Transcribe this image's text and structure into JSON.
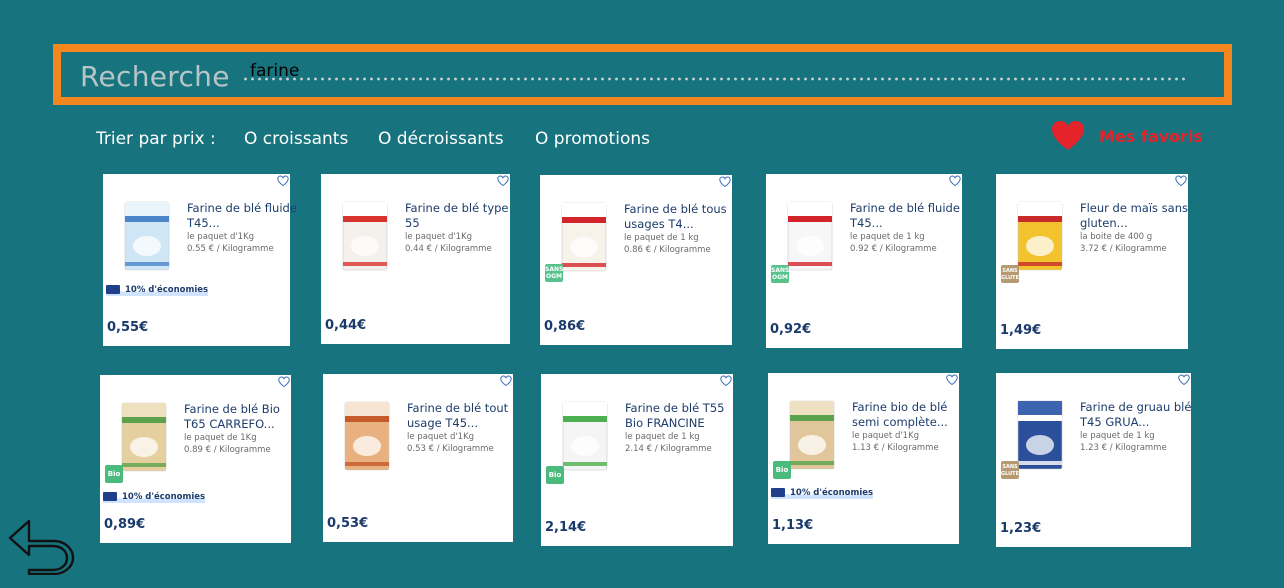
{
  "search": {
    "label": "Recherche",
    "value": "farine"
  },
  "sort": {
    "title": "Trier par prix :",
    "options": [
      "O croissants",
      "O décroissants",
      "O promotions"
    ]
  },
  "favorites": {
    "label": "Mes favoris"
  },
  "colors": {
    "background": "#17747f",
    "search_border": "#f4861f",
    "favorites": "#e4242a",
    "price": "#1a3a6b"
  },
  "icons": {
    "back": "back-arrow-icon",
    "favorite": "heart-icon"
  },
  "products": [
    {
      "name": "Farine de blé fluide T45...",
      "unit": "le paquet d'1Kg",
      "price_per_kg": "0.55 € / Kilogramme",
      "promo": "10% d'économies",
      "price": "0,55€",
      "badge": "",
      "image": "package-blue"
    },
    {
      "name": "Farine de blé type 55",
      "unit": "le paquet d'1Kg",
      "price_per_kg": "0.44 € / Kilogramme",
      "promo": "",
      "price": "0,44€",
      "badge": "",
      "image": "package-white"
    },
    {
      "name": "Farine de blé tous usages T4...",
      "unit": "le paquet de 1 kg",
      "price_per_kg": "0.86 € / Kilogramme",
      "promo": "",
      "price": "0,86€",
      "badge": "SANS OGM",
      "image": "package-francine"
    },
    {
      "name": "Farine de blé fluide T45...",
      "unit": "le paquet de 1 kg",
      "price_per_kg": "0.92 € / Kilogramme",
      "promo": "",
      "price": "0,92€",
      "badge": "SANS OGM",
      "image": "package-francine-blue"
    },
    {
      "name": "Fleur de maïs sans gluten...",
      "unit": "la boite de 400 g",
      "price_per_kg": "3.72 € / Kilogramme",
      "promo": "",
      "price": "1,49€",
      "badge": "SANS GLUTEN",
      "image": "box-maizena"
    },
    {
      "name": "Farine de blé Bio T65 CARREFO...",
      "unit": "le paquet de 1Kg",
      "price_per_kg": "0.89 € / Kilogramme",
      "promo": "10% d'économies",
      "price": "0,89€",
      "badge": "Bio",
      "image": "package-bio-kraft"
    },
    {
      "name": "Farine de blé tout usage T45...",
      "unit": "le paquet d'1Kg",
      "price_per_kg": "0.53 € / Kilogramme",
      "promo": "",
      "price": "0,53€",
      "badge": "",
      "image": "package-orange"
    },
    {
      "name": "Farine de blé T55 Bio FRANCINE",
      "unit": "le paquet de 1 kg",
      "price_per_kg": "2.14 € / Kilogramme",
      "promo": "",
      "price": "2,14€",
      "badge": "Bio",
      "image": "package-francine-bio"
    },
    {
      "name": "Farine bio de blé semi complète...",
      "unit": "le paquet d'1Kg",
      "price_per_kg": "1.13 € / Kilogramme",
      "promo": "10% d'économies",
      "price": "1,13€",
      "badge": "Bio",
      "image": "package-bio-kraft-2"
    },
    {
      "name": "Farine de gruau blé T45 GRUA...",
      "unit": "le paquet de 1 kg",
      "price_per_kg": "1.23 € / Kilogramme",
      "promo": "",
      "price": "1,23€",
      "badge": "SANS GLUTEN",
      "image": "package-ble-blue"
    }
  ]
}
